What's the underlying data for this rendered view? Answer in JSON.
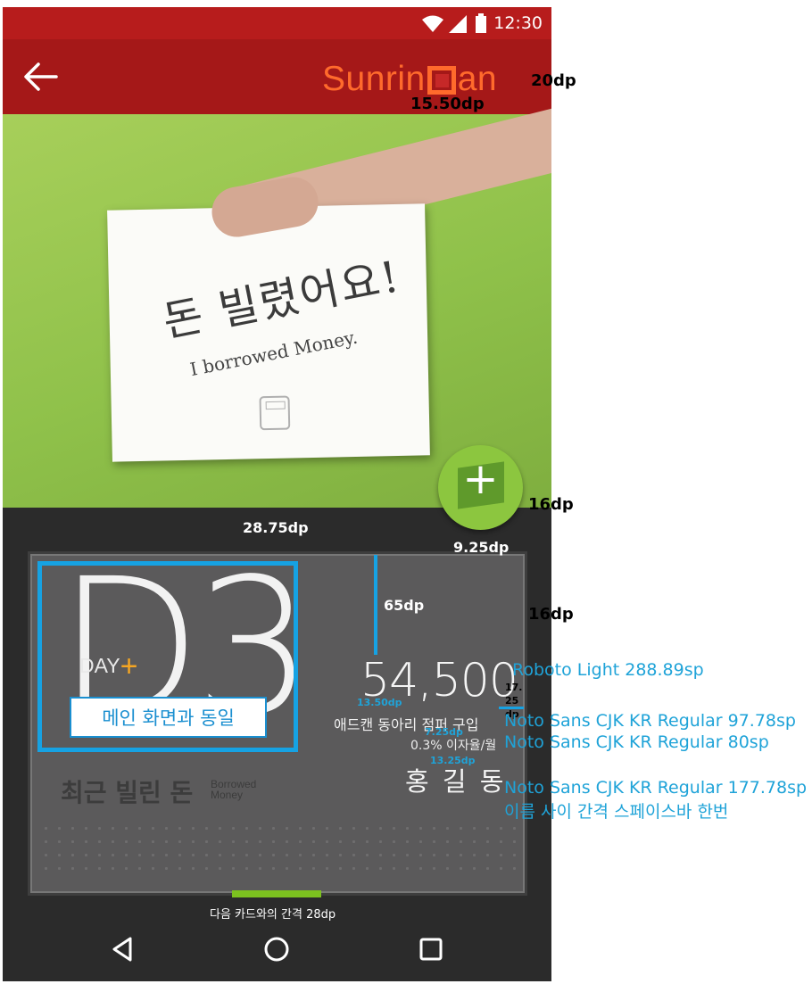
{
  "status_bar": {
    "time": "12:30"
  },
  "app_bar": {
    "logo_left": "Sunrin",
    "logo_right": "an"
  },
  "hero": {
    "note_korean": "돈 빌렸어요!",
    "note_english": "I borrowed Money."
  },
  "card": {
    "big_number": "D3",
    "day_label": "DAY",
    "day_plus": "+",
    "amount": "54,500",
    "purpose": "애드캔 동아리 점퍼 구입",
    "rate": "0.3% 이자율/월",
    "name": "홍 길 동",
    "recent_label": "최근 빌린 돈",
    "recent_label_en_1": "Borrowed",
    "recent_label_en_2": "Money"
  },
  "fab": {
    "icon": "+"
  },
  "annotations": {
    "appbar_height": "20dp",
    "logo_margin": "15.50dp",
    "fab_right": "16dp",
    "card_top": "28.75dp",
    "fab_overlap": "9.25dp",
    "card_right": "16dp",
    "amount_top": "65dp",
    "same_as_main": "메인 화면과 동일",
    "font_amount": "Roboto Light 288.89sp",
    "gap_amount_purpose": "13.50dp",
    "right_margin_1": "17.",
    "right_margin_2": "25",
    "right_margin_3": "dp",
    "font_purpose": "Noto Sans CJK KR Regular 97.78sp",
    "gap_purpose_rate": "7.25dp",
    "font_rate": "Noto Sans CJK KR Regular 80sp",
    "gap_rate_name": "13.25dp",
    "font_name": "Noto Sans CJK KR Regular 177.78sp",
    "name_spacing": "이름 사이 간격 스페이스바 한번",
    "card_gap": "다음 카드와의 간격 28dp"
  },
  "colors": {
    "status_bar": "#b71c1c",
    "app_bar": "#a51818",
    "logo": "#ff6a2c",
    "fab": "#8cc63f",
    "indicator": "#7cc11f",
    "annotation_blue": "#16a2e3",
    "day_plus": "#f5a623"
  },
  "icons": {
    "status": [
      "wifi-icon",
      "signal-icon",
      "battery-icon"
    ],
    "nav": [
      "back-triangle-icon",
      "home-circle-icon",
      "recents-square-icon"
    ],
    "appbar": "back-arrow-icon"
  }
}
